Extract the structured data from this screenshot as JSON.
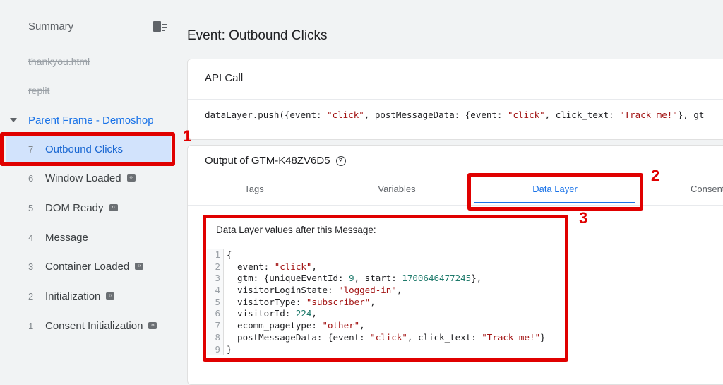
{
  "sidebar": {
    "summary": "Summary",
    "clear_icon": "delete-list-icon",
    "pages": [
      "thankyou.html",
      "replit"
    ],
    "frame": "Parent Frame - Demoshop",
    "events": [
      {
        "num": "7",
        "label": "Outbound Clicks",
        "selected": true,
        "tag": false
      },
      {
        "num": "6",
        "label": "Window Loaded",
        "tag": true
      },
      {
        "num": "5",
        "label": "DOM Ready",
        "tag": true
      },
      {
        "num": "4",
        "label": "Message",
        "tag": false
      },
      {
        "num": "3",
        "label": "Container Loaded",
        "tag": true
      },
      {
        "num": "2",
        "label": "Initialization",
        "tag": true
      },
      {
        "num": "1",
        "label": "Consent Initialization",
        "tag": true
      }
    ]
  },
  "main": {
    "title": "Event: Outbound Clicks",
    "api_call": {
      "heading": "API Call",
      "code": "dataLayer.push({event: \"click\", postMessageData: {event: \"click\", click_text: \"Track me!\"}, gt"
    },
    "output": {
      "heading": "Output of GTM-K48ZV6D5",
      "tabs": [
        "Tags",
        "Variables",
        "Data Layer",
        "Consent"
      ],
      "active_tab": "Data Layer"
    },
    "data_layer": {
      "heading": "Data Layer values after this Message:",
      "lines": [
        "{",
        "  event: \"click\",",
        "  gtm: {uniqueEventId: 9, start: 1700646477245},",
        "  visitorLoginState: \"logged-in\",",
        "  visitorType: \"subscriber\",",
        "  visitorId: 224,",
        "  ecomm_pagetype: \"other\",",
        "  postMessageData: {event: \"click\", click_text: \"Track me!\"}",
        "}"
      ]
    }
  },
  "annotations": [
    "1",
    "2",
    "3"
  ],
  "colors": {
    "accent": "#1a73e8",
    "selected_bg": "#d2e3fc",
    "annotation": "#e00000"
  }
}
